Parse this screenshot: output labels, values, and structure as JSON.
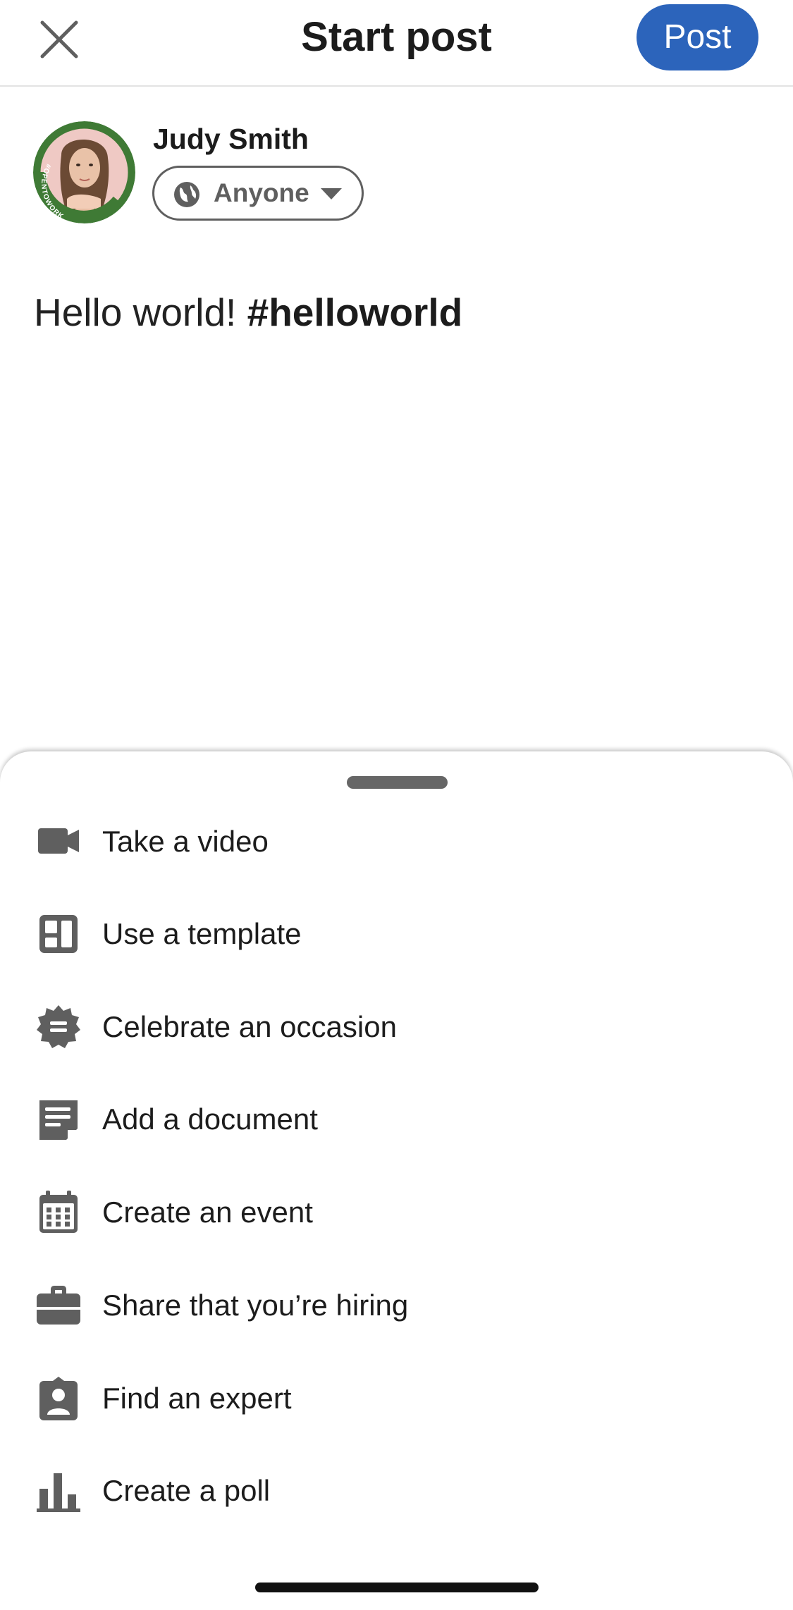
{
  "header": {
    "title": "Start post",
    "post_label": "Post",
    "accent_color": "#2c64bb"
  },
  "author": {
    "name": "Judy Smith",
    "audience": "Anyone",
    "avatar_badge_text": "#OPENTOWORK"
  },
  "composer": {
    "text": "Hello world! ",
    "hashtag": "#helloworld"
  },
  "sheet": {
    "options": [
      {
        "label": "Take a video",
        "icon": "video-icon"
      },
      {
        "label": "Use a template",
        "icon": "template-icon"
      },
      {
        "label": "Celebrate an occasion",
        "icon": "celebrate-icon"
      },
      {
        "label": "Add a document",
        "icon": "document-icon"
      },
      {
        "label": "Create an event",
        "icon": "calendar-icon"
      },
      {
        "label": "Share that you’re hiring",
        "icon": "briefcase-icon"
      },
      {
        "label": "Find an expert",
        "icon": "expert-icon"
      },
      {
        "label": "Create a poll",
        "icon": "poll-icon"
      }
    ]
  }
}
